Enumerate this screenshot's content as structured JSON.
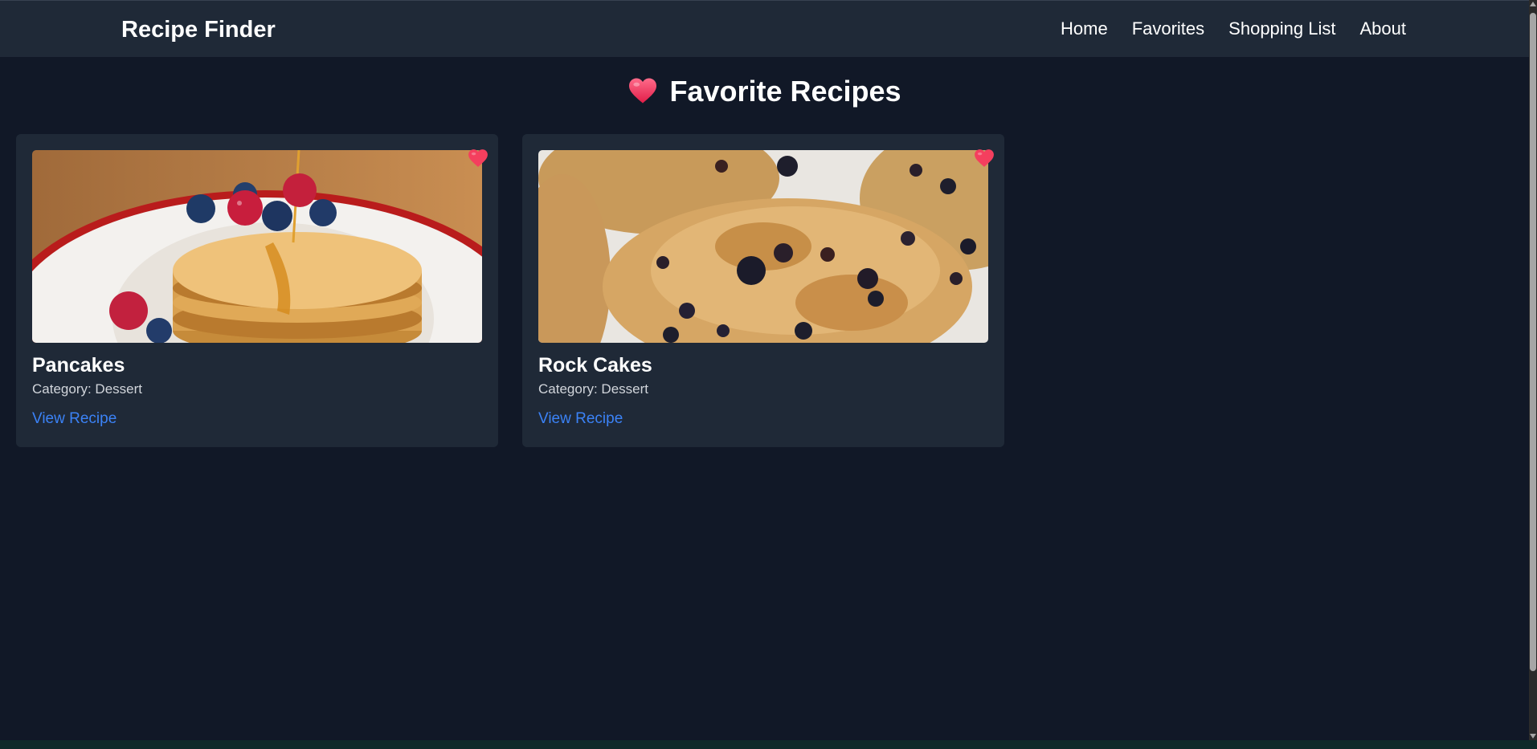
{
  "header": {
    "brand": "Recipe Finder",
    "nav": [
      {
        "label": "Home"
      },
      {
        "label": "Favorites"
      },
      {
        "label": "Shopping List"
      },
      {
        "label": "About"
      }
    ]
  },
  "main": {
    "heading": "Favorite Recipes",
    "heading_icon": "heart-icon",
    "cards": [
      {
        "title": "Pancakes",
        "category": "Category: Dessert",
        "link": "View Recipe",
        "image": "pancakes-photo",
        "fav_icon": "heart-icon"
      },
      {
        "title": "Rock Cakes",
        "category": "Category: Dessert",
        "link": "View Recipe",
        "image": "rock-cakes-photo",
        "fav_icon": "heart-icon"
      }
    ]
  },
  "colors": {
    "background": "#111827",
    "surface": "#1f2937",
    "accent_link": "#3b82f6",
    "heart": "#f43f5e"
  }
}
